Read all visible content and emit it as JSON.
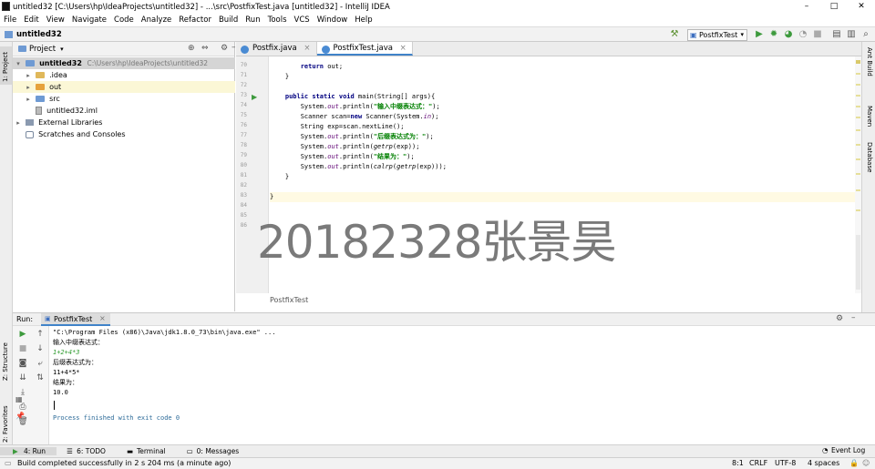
{
  "window": {
    "title": "untitled32 [C:\\Users\\hp\\IdeaProjects\\untitled32] - ...\\src\\PostfixTest.java [untitled32] - IntelliJ IDEA",
    "minimize": "–",
    "maximize": "□",
    "close": "✕"
  },
  "menu": [
    "File",
    "Edit",
    "View",
    "Navigate",
    "Code",
    "Analyze",
    "Refactor",
    "Build",
    "Run",
    "Tools",
    "VCS",
    "Window",
    "Help"
  ],
  "navbar": {
    "project_name": "untitled32",
    "run_config": "PostfixTest"
  },
  "left_strip": {
    "project_tab": "1: Project",
    "structure_tab": "Z: Structure",
    "favorites_tab": "2: Favorites"
  },
  "right_strip": {
    "ant": "Ant Build",
    "maven": "Maven",
    "database": "Database"
  },
  "project_panel": {
    "header": "Project",
    "tree": [
      {
        "label": "untitled32",
        "path": "C:\\Users\\hp\\IdeaProjects\\untitled32",
        "depth": 0,
        "type": "module",
        "expanded": true
      },
      {
        "label": ".idea",
        "depth": 1,
        "type": "folder",
        "expanded": false
      },
      {
        "label": "out",
        "depth": 1,
        "type": "folder-orange",
        "expanded": false
      },
      {
        "label": "src",
        "depth": 1,
        "type": "folder-blue",
        "expanded": false
      },
      {
        "label": "untitled32.iml",
        "depth": 1,
        "type": "file"
      },
      {
        "label": "External Libraries",
        "depth": 0,
        "type": "lib",
        "expanded": false
      },
      {
        "label": "Scratches and Consoles",
        "depth": 0,
        "type": "scratch"
      }
    ]
  },
  "editor": {
    "tabs": [
      {
        "label": "Postfix.java",
        "active": false
      },
      {
        "label": "PostfixTest.java",
        "active": true
      }
    ],
    "line_numbers": [
      "70",
      "71",
      "72",
      "73",
      "74",
      "75",
      "76",
      "77",
      "78",
      "79",
      "80",
      "81",
      "82",
      "83",
      "84",
      "85",
      "86"
    ],
    "breadcrumb": "PostfixTest",
    "code": {
      "l70_kw": "return",
      "l70_rest": " out;",
      "l71": "}",
      "l73_kw": "public static void",
      "l73_rest": " main(String[] args){",
      "l74_a": "System.",
      "l74_b": "out",
      "l74_c": ".println(",
      "l74_d": "\"输入中缀表达式：\"",
      "l74_e": ");",
      "l75_a": "Scanner scan=",
      "l75_b": "new",
      "l75_c": " Scanner(System.",
      "l75_d": "in",
      "l75_e": ");",
      "l76": "String exp=scan.nextLine();",
      "l77_a": "System.",
      "l77_b": "out",
      "l77_c": ".println(",
      "l77_d": "\"后缀表达式为：\"",
      "l77_e": ");",
      "l78_a": "System.",
      "l78_b": "out",
      "l78_c": ".println(",
      "l78_d": "getrp",
      "l78_e": "(exp));",
      "l79_a": "System.",
      "l79_b": "out",
      "l79_c": ".println(",
      "l79_d": "\"结果为：\"",
      "l79_e": ");",
      "l80_a": "System.",
      "l80_b": "out",
      "l80_c": ".println(",
      "l80_d": "calrp",
      "l80_e": "(",
      "l80_f": "getrp",
      "l80_g": "(exp)));",
      "l81": "}",
      "l83": "}"
    }
  },
  "watermark": "20182328张景昊",
  "run_panel": {
    "label": "Run:",
    "tab": "PostfixTest",
    "console": [
      {
        "text": "\"C:\\Program Files (x86)\\Java\\jdk1.8.0_73\\bin\\java.exe\" ...",
        "kind": "cmd"
      },
      {
        "text": "输入中缀表达式：",
        "kind": "out"
      },
      {
        "text": "1+2+4*3",
        "kind": "inp"
      },
      {
        "text": "后缀表达式为：",
        "kind": "out"
      },
      {
        "text": "11+4*5*",
        "kind": "out"
      },
      {
        "text": "结果为：",
        "kind": "out"
      },
      {
        "text": "10.0",
        "kind": "out"
      },
      {
        "text": "",
        "kind": "out"
      },
      {
        "text": "Process finished with exit code 0",
        "kind": "exit"
      }
    ]
  },
  "bottom_tabs": [
    "4: Run",
    "6: TODO",
    "Terminal",
    "0: Messages"
  ],
  "event_log": "Event Log",
  "status": {
    "message": "Build completed successfully in 2 s 204 ms (a minute ago)",
    "position": "8:1",
    "line_sep": "CRLF",
    "encoding": "UTF-8",
    "indent": "4 spaces"
  },
  "colors": {
    "keyword": "#000080",
    "string": "#008000",
    "field": "#660e7a",
    "selected_tab": "#4083c9",
    "run_green": "#3d9a3d"
  }
}
